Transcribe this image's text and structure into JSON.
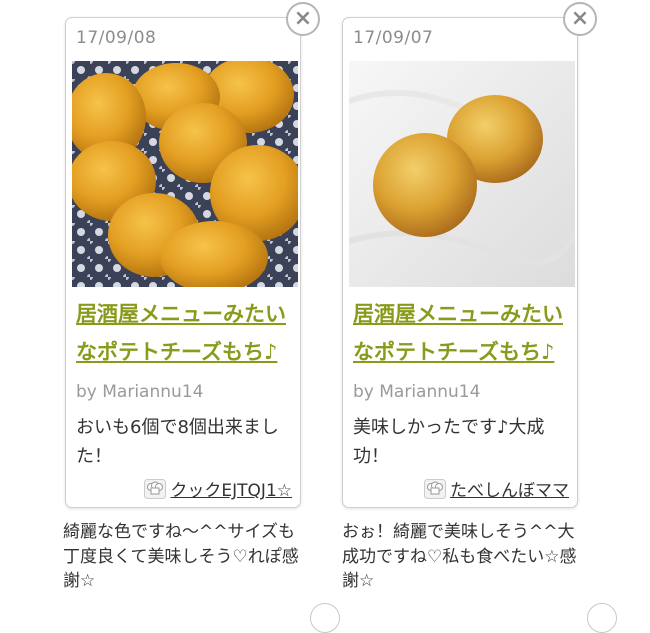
{
  "cards": [
    {
      "date": "17/09/08",
      "recipe_title": "居酒屋メニューみたいなポテトチーズもち♪",
      "byline": "by Mariannu14",
      "comment": "おいも6個で8個出来ました！",
      "author_name": "クックEJTQJ1☆",
      "reply": "綺麗な色ですね〜^^サイズも丁度良くて美味しそう♡れぽ感謝☆",
      "close_icon": "close-x-icon",
      "author_icon": "chef-hat-icon"
    },
    {
      "date": "17/09/07",
      "recipe_title": "居酒屋メニューみたいなポテトチーズもち♪",
      "byline": "by Mariannu14",
      "comment": "美味しかったです♪大成功！",
      "author_name": "たべしんぼママ",
      "reply": "おぉ！綺麗で美味しそう^^大成功ですね♡私も食べたい☆感謝☆",
      "close_icon": "close-x-icon",
      "author_icon": "chef-hat-icon"
    }
  ],
  "colors": {
    "link_green": "#8a9a1a",
    "date_gray": "#8c8c8c",
    "byline_gray": "#9a9a9a",
    "card_border": "#cfcfcf",
    "text": "#333333"
  }
}
